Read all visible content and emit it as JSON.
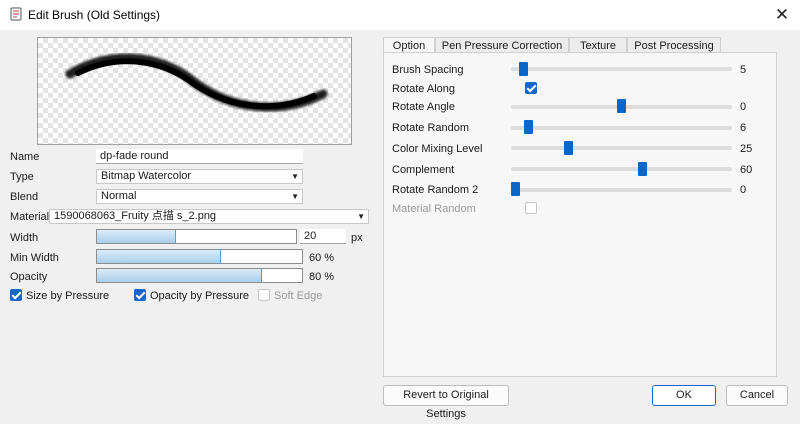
{
  "window": {
    "title": "Edit Brush (Old Settings)"
  },
  "left": {
    "name_label": "Name",
    "name_value": "dp-fade round",
    "type_label": "Type",
    "type_value": "Bitmap Watercolor",
    "blend_label": "Blend",
    "blend_value": "Normal",
    "material_label": "Material",
    "material_value": "1590068063_Fruity 点描 s_2.png",
    "width_label": "Width",
    "width_value": "20",
    "width_unit": "px",
    "width_fill": 0.39,
    "minwidth_label": "Min Width",
    "minwidth_value": "60 %",
    "minwidth_fill": 0.6,
    "opacity_label": "Opacity",
    "opacity_value": "80 %",
    "opacity_fill": 0.8,
    "size_by_pressure": "Size by Pressure",
    "opacity_by_pressure": "Opacity by Pressure",
    "soft_edge": "Soft Edge"
  },
  "tabs": [
    "Option",
    "Pen Pressure Correction",
    "Texture",
    "Post Processing"
  ],
  "options": {
    "brush_spacing": {
      "label": "Brush Spacing",
      "value": "5",
      "pos": 0.04
    },
    "rotate_along": {
      "label": "Rotate Along",
      "checked": true
    },
    "rotate_angle": {
      "label": "Rotate Angle",
      "value": "0",
      "pos": 0.5
    },
    "rotate_random": {
      "label": "Rotate Random",
      "value": "6",
      "pos": 0.06
    },
    "color_mixing": {
      "label": "Color Mixing Level",
      "value": "25",
      "pos": 0.25
    },
    "complement": {
      "label": "Complement",
      "value": "60",
      "pos": 0.6
    },
    "rotate_random2": {
      "label": "Rotate Random 2",
      "value": "0",
      "pos": 0.0
    },
    "material_random": {
      "label": "Material Random",
      "checked": false
    }
  },
  "buttons": {
    "revert": "Revert to Original Settings",
    "ok": "OK",
    "cancel": "Cancel"
  }
}
